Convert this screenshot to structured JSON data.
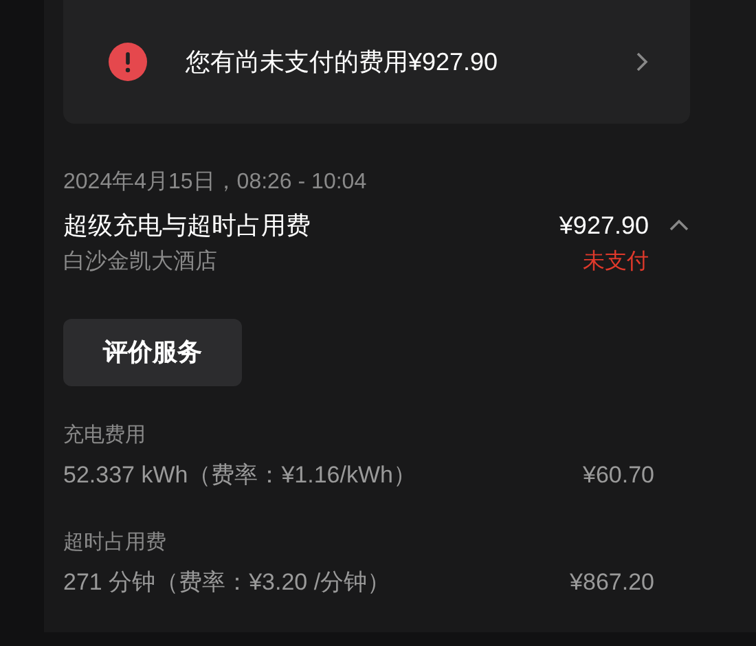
{
  "alert": {
    "text": "您有尚未支付的费用¥927.90"
  },
  "order": {
    "datetime": "2024年4月15日，08:26 - 10:04",
    "title": "超级充电与超时占用费",
    "location": "白沙金凯大酒店",
    "total": "¥927.90",
    "status": {
      "kind": "unpaid",
      "text": "未支付"
    },
    "expanded": true
  },
  "review_button": "评价服务",
  "charges": [
    {
      "label": "充电费用",
      "detail": "52.337 kWh（费率：¥1.16/kWh）",
      "amount": "¥60.70"
    },
    {
      "label": "超时占用费",
      "detail": "271 分钟（费率：¥3.20 /分钟）",
      "amount": "¥867.20"
    }
  ]
}
